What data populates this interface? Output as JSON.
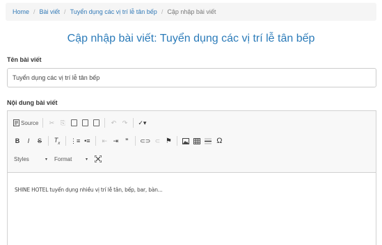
{
  "breadcrumb": {
    "items": [
      "Home",
      "Bài viết",
      "Tuyển dụng các vị trí lễ tân bếp"
    ],
    "current": "Cập nhập bài viết",
    "separator": "/"
  },
  "page_title": "Cập nhập bài viết: Tuyển dụng các vị trí lễ tân bếp",
  "form": {
    "title_label": "Tên bài viết",
    "title_value": "Tuyển dụng các vị trí lễ tân bếp",
    "content_label": "Nội dung bài viết"
  },
  "editor": {
    "source_label": "Source",
    "styles_label": "Styles",
    "format_label": "Format",
    "content_text": "SHINE HOTEL tuyển dụng nhiều vị trí lễ tân, bếp, bar, bàn..."
  },
  "colors": {
    "link": "#337ab7",
    "title": "#2b7bb9",
    "breadcrumb_bg": "#f5f5f5"
  }
}
